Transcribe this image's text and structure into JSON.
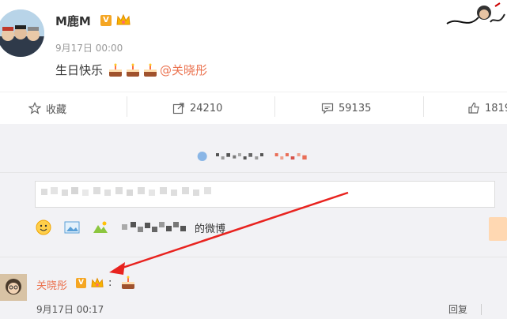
{
  "post": {
    "author": "M鹿M",
    "verified_badge": "V",
    "time": "9月17日 00:00",
    "text": "生日快乐",
    "mention": "@关晓彤",
    "cake_count": 3
  },
  "actions": {
    "favorite_label": "收藏",
    "repost_count": "24210",
    "comment_count": "59135",
    "like_count": "1819"
  },
  "comment_box": {
    "toolbar_suffix": "的微博"
  },
  "reply": {
    "author": "关晓彤",
    "verified_badge": "V",
    "colon": ":",
    "time": "9月17日 00:17",
    "reply_label": "回复"
  },
  "colors": {
    "accent": "#eb7350",
    "badge": "#f5a623",
    "arrow": "#e8231f",
    "background": "#f2f2f5"
  },
  "icons": [
    "crown-icon",
    "cake-icon",
    "star-icon",
    "share-icon",
    "comment-icon",
    "thumb-up-icon",
    "emoji-icon",
    "image-icon",
    "topic-icon",
    "more-icon"
  ]
}
